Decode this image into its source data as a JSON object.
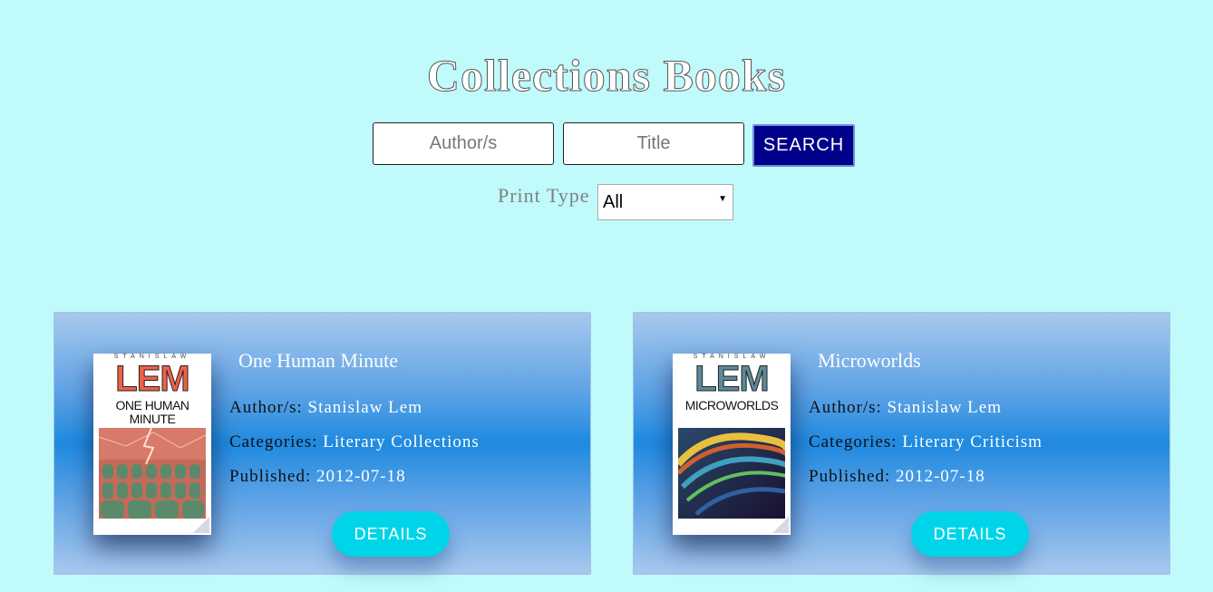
{
  "header": {
    "title": "Collections Books"
  },
  "search": {
    "author_placeholder": "Author/s",
    "title_placeholder": "Title",
    "button_label": "SEARCH",
    "print_type_label": "Print Type",
    "print_type_value": "All"
  },
  "books": [
    {
      "title": "One Human Minute",
      "author_label": "Author/s:",
      "author": "Stanislaw Lem",
      "categories_label": "Categories:",
      "categories": "Literary Collections",
      "published_label": "Published:",
      "published": "2012-07-18",
      "details_label": "DETAILS",
      "cover": {
        "top": "STANISLAW",
        "name": "LEM",
        "subtitle": "ONE HUMAN MINUTE",
        "name_color": "#f06048"
      }
    },
    {
      "title": "Microworlds",
      "author_label": "Author/s:",
      "author": "Stanislaw Lem",
      "categories_label": "Categories:",
      "categories": "Literary Criticism",
      "published_label": "Published:",
      "published": "2012-07-18",
      "details_label": "DETAILS",
      "cover": {
        "top": "STANISLAW",
        "name": "LEM",
        "subtitle": "MICROWORLDS",
        "name_color": "#5a8a9a"
      }
    }
  ],
  "colors": {
    "background": "#c0fafa",
    "search_button": "#00008b",
    "details_button": "#00d4e8"
  }
}
